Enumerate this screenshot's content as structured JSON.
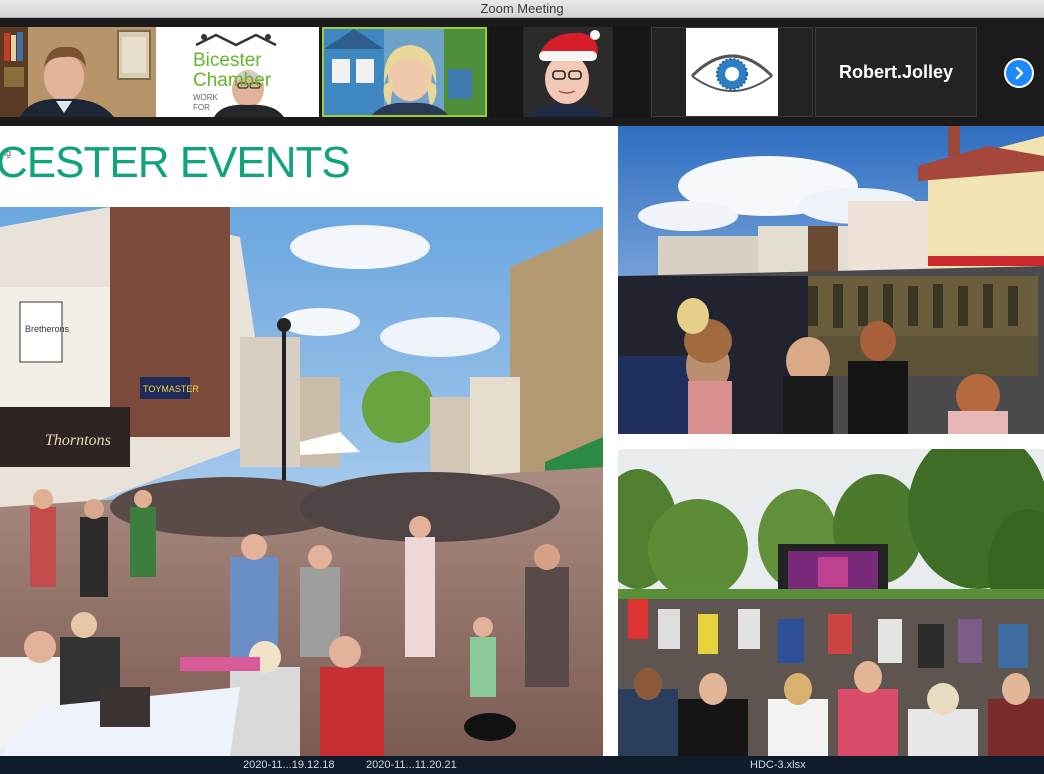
{
  "window": {
    "title": "Zoom Meeting"
  },
  "participants": [
    {
      "id": "p1",
      "kind": "video"
    },
    {
      "id": "p2",
      "kind": "video",
      "logo_line1": "Bicester",
      "logo_line2": "Chamber",
      "logo_line3": "WORK",
      "logo_line4": "FOR"
    },
    {
      "id": "p3",
      "kind": "video",
      "active_speaker": true
    },
    {
      "id": "p4",
      "kind": "video"
    },
    {
      "id": "p5",
      "kind": "logo",
      "icon": "eye-icon"
    },
    {
      "id": "p6",
      "kind": "name",
      "name": "Robert.Jolley"
    }
  ],
  "strip": {
    "next_icon": "chevron-right-icon"
  },
  "slide": {
    "title": "CESTER EVENTS",
    "tiny_text": "ng",
    "sign_shop1": "Bretherons",
    "sign_shop2": "Thorntons",
    "sign_shop3": "TOYMASTER"
  },
  "bottom": {
    "file1": "2020-11...19.12.18",
    "file2": "2020-11...11.20.21",
    "file3": "HDC-3.xlsx"
  },
  "colors": {
    "accent_green": "#11a37e",
    "active_border": "#9ccc3c",
    "next_button": "#1e88ff"
  }
}
